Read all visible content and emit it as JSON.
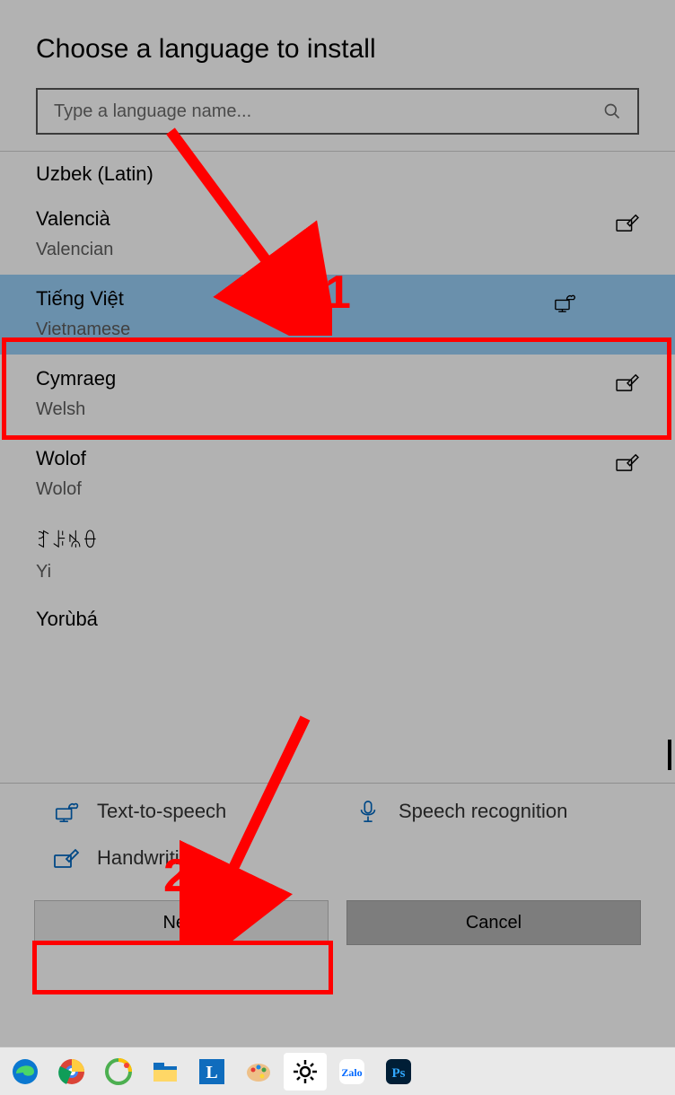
{
  "dialog": {
    "title": "Choose a language to install",
    "search": {
      "placeholder": "Type a language name..."
    }
  },
  "languages": [
    {
      "native": "Uzbek (Latin)",
      "english": "",
      "partial": true
    },
    {
      "native": "Valencià",
      "english": "Valencian",
      "icons": [
        "handwriting"
      ]
    },
    {
      "native": "Tiếng Việt",
      "english": "Vietnamese",
      "selected": true,
      "icons": [
        "tts"
      ]
    },
    {
      "native": "Cymraeg",
      "english": "Welsh",
      "icons": [
        "handwriting"
      ]
    },
    {
      "native": "Wolof",
      "english": "Wolof",
      "icons": [
        "handwriting"
      ]
    },
    {
      "native": "ꆈꌠꁱꂷ",
      "english": "Yi"
    },
    {
      "native": "Yorùbá",
      "english": "",
      "partial": true
    }
  ],
  "legend": {
    "tts": "Text-to-speech",
    "speech": "Speech recognition",
    "handwriting": "Handwriting"
  },
  "buttons": {
    "next": "Next",
    "cancel": "Cancel"
  },
  "annotations": {
    "step1": "1",
    "step2": "2"
  },
  "taskbar": {
    "apps": [
      "edge",
      "chrome",
      "coccoc",
      "explorer",
      "lapp",
      "paint",
      "settings",
      "zalo",
      "photoshop"
    ]
  }
}
